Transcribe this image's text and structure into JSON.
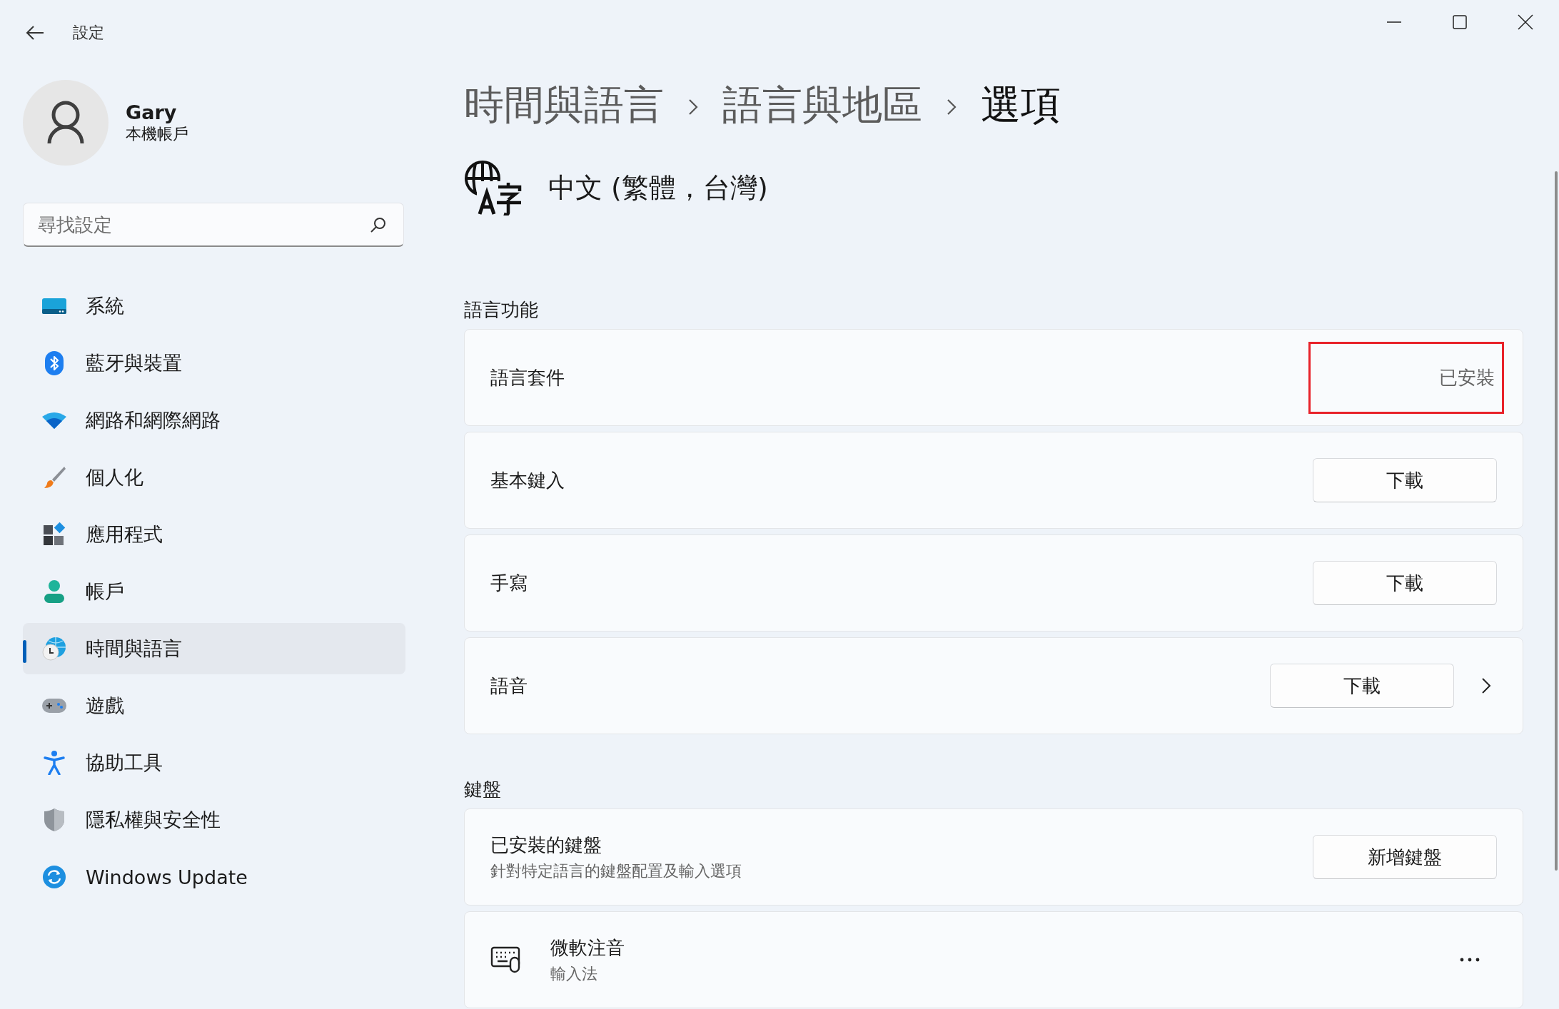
{
  "window": {
    "title": "設定"
  },
  "user": {
    "name": "Gary",
    "account_type": "本機帳戶"
  },
  "search": {
    "placeholder": "尋找設定"
  },
  "sidebar": {
    "items": [
      {
        "label": "系統",
        "selected": false
      },
      {
        "label": "藍牙與裝置",
        "selected": false
      },
      {
        "label": "網路和網際網路",
        "selected": false
      },
      {
        "label": "個人化",
        "selected": false
      },
      {
        "label": "應用程式",
        "selected": false
      },
      {
        "label": "帳戶",
        "selected": false
      },
      {
        "label": "時間與語言",
        "selected": true
      },
      {
        "label": "遊戲",
        "selected": false
      },
      {
        "label": "協助工具",
        "selected": false
      },
      {
        "label": "隱私權與安全性",
        "selected": false
      },
      {
        "label": "Windows Update",
        "selected": false
      }
    ]
  },
  "breadcrumb": [
    "時間與語言",
    "語言與地區",
    "選項"
  ],
  "language": {
    "name": "中文 (繁體，台灣)"
  },
  "sections": [
    {
      "title": "語言功能",
      "rows": [
        {
          "kind": "status",
          "label": "語言套件",
          "status": "已安裝",
          "highlighted": true
        },
        {
          "kind": "button",
          "label": "基本鍵入",
          "button": "下載",
          "expandable": false
        },
        {
          "kind": "button",
          "label": "手寫",
          "button": "下載",
          "expandable": false
        },
        {
          "kind": "button",
          "label": "語音",
          "button": "下載",
          "expandable": true
        }
      ]
    },
    {
      "title": "鍵盤",
      "rows": [
        {
          "kind": "button",
          "label": "已安裝的鍵盤",
          "description": "針對特定語言的鍵盤配置及輸入選項",
          "button": "新增鍵盤",
          "expandable": false
        },
        {
          "kind": "menu",
          "label": "微軟注音",
          "description": "輸入法"
        }
      ]
    }
  ]
}
